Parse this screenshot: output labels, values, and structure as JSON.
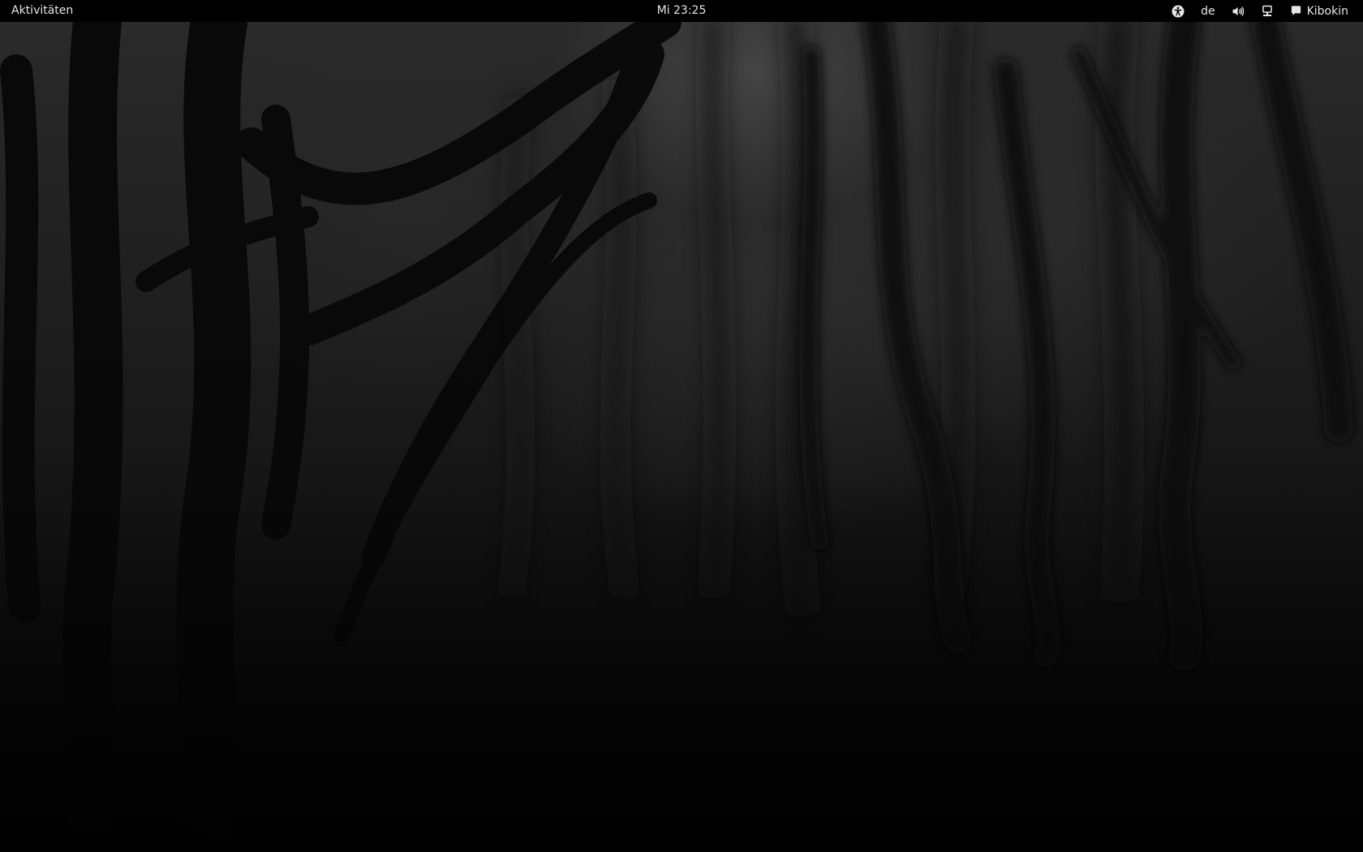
{
  "topbar": {
    "activities_label": "Aktivitäten",
    "clock": "Mi 23:25",
    "keyboard_layout": "de",
    "user_name": "Kibokin",
    "icons": {
      "accessibility": "accessibility-icon",
      "volume": "volume-icon",
      "network": "network-icon",
      "chat": "chat-bubble-icon"
    }
  },
  "colors": {
    "topbar_bg": "#000000",
    "topbar_text": "#e6e6e6"
  },
  "wallpaper": {
    "name": "dark-forest-wallpaper"
  }
}
